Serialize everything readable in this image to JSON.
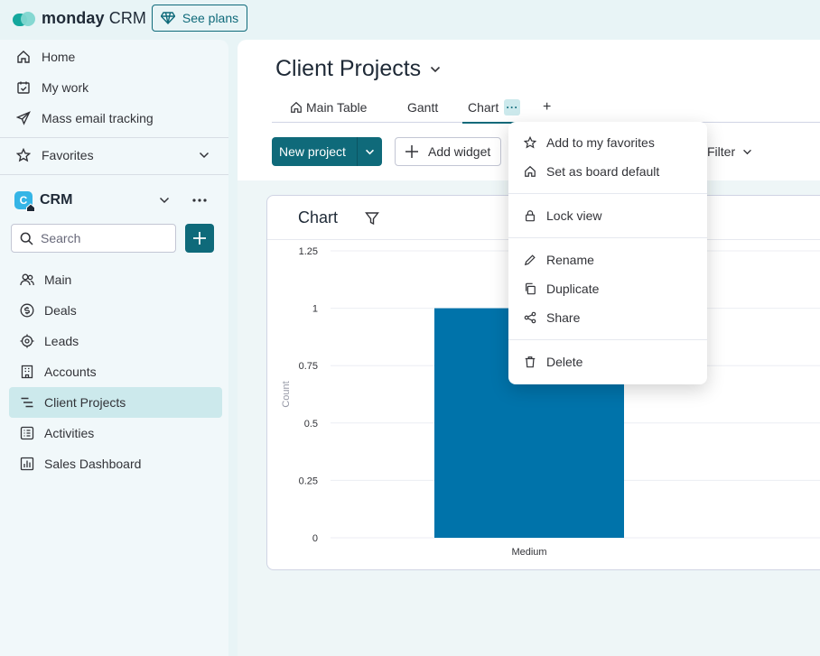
{
  "app": {
    "brand_bold": "monday",
    "brand_light": "CRM",
    "see_plans": "See plans"
  },
  "sidebar": {
    "top_items": [
      {
        "label": "Home",
        "icon": "home-icon"
      },
      {
        "label": "My work",
        "icon": "calendar-check-icon"
      },
      {
        "label": "Mass email tracking",
        "icon": "send-icon"
      }
    ],
    "favorites": "Favorites",
    "workspace": {
      "badge": "C",
      "label": "CRM"
    },
    "search_placeholder": "Search",
    "boards": [
      {
        "label": "Main",
        "icon": "people-icon"
      },
      {
        "label": "Deals",
        "icon": "dollar-icon"
      },
      {
        "label": "Leads",
        "icon": "target-icon"
      },
      {
        "label": "Accounts",
        "icon": "building-icon"
      },
      {
        "label": "Client Projects",
        "icon": "gantt-icon",
        "active": true
      },
      {
        "label": "Activities",
        "icon": "list-icon"
      },
      {
        "label": "Sales Dashboard",
        "icon": "chart-icon"
      }
    ]
  },
  "board": {
    "title": "Client Projects",
    "tabs": [
      {
        "label": "Main Table"
      },
      {
        "label": "Gantt"
      },
      {
        "label": "Chart",
        "active": true
      }
    ],
    "add_tab": "+",
    "new_project": "New project",
    "add_widget": "Add widget",
    "filter": "Filter"
  },
  "chart_card": {
    "title": "Chart"
  },
  "chart_data": {
    "type": "bar",
    "categories": [
      "Medium"
    ],
    "values": [
      1
    ],
    "ylabel": "Count",
    "xlabel": "",
    "ylim": [
      0,
      1.25
    ],
    "yticks": [
      "0",
      "0.25",
      "0.5",
      "0.75",
      "1",
      "1.25"
    ],
    "bar_color": "#0073aa",
    "grid": true
  },
  "view_menu": {
    "groups": [
      [
        {
          "label": "Add to my favorites",
          "icon": "star-icon"
        },
        {
          "label": "Set as board default",
          "icon": "home-icon"
        }
      ],
      [
        {
          "label": "Lock view",
          "icon": "lock-icon"
        }
      ],
      [
        {
          "label": "Rename",
          "icon": "pencil-icon"
        },
        {
          "label": "Duplicate",
          "icon": "duplicate-icon"
        },
        {
          "label": "Share",
          "icon": "share-icon"
        }
      ],
      [
        {
          "label": "Delete",
          "icon": "trash-icon"
        }
      ]
    ]
  },
  "colors": {
    "accent": "#0f6a7a",
    "active_nav": "#cce9ec",
    "bar": "#0073aa"
  }
}
